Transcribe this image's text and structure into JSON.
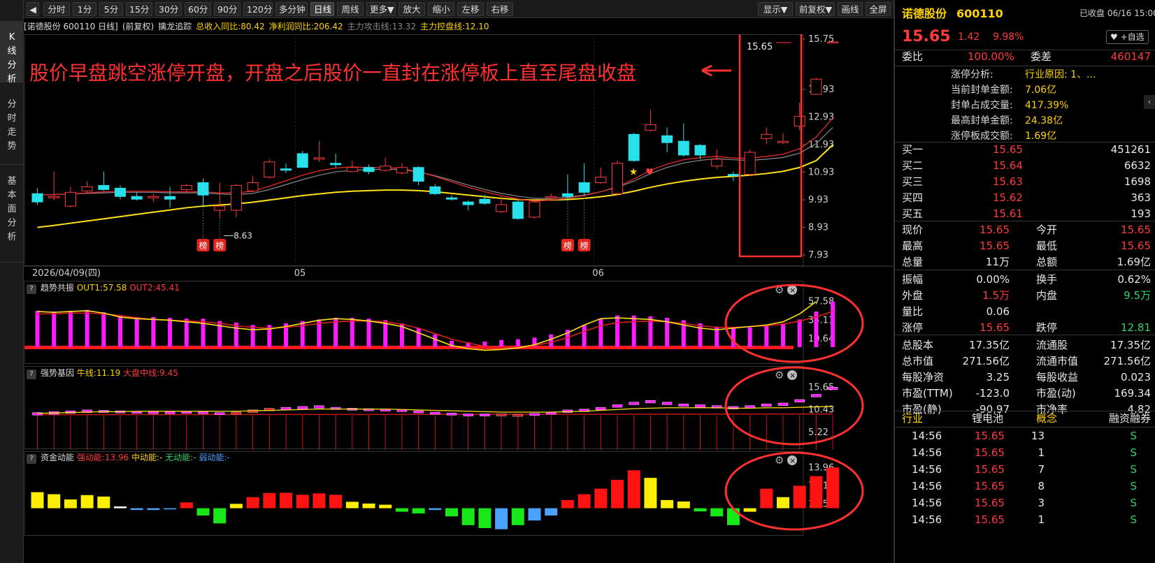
{
  "toolbar": {
    "collapse_icon": "left-arrow-icon",
    "periods": [
      "分时",
      "1分",
      "5分",
      "15分",
      "30分",
      "60分",
      "90分",
      "120分",
      "多分钟",
      "日线",
      "周线",
      "更多▼",
      "放大",
      "缩小",
      "左移",
      "右移"
    ],
    "active_period": "日线",
    "right_items": [
      "显示▼",
      "前复权▼",
      "画线",
      "全屏"
    ]
  },
  "left_tabs": [
    "K线分析",
    "分时走势",
    "基本面分析"
  ],
  "info_bar": {
    "stock": "[诺德股份 600110 日线]",
    "adjust": "(前复权)",
    "indicator": "擒龙追踪",
    "income_growth": "总收入同比:80.42",
    "profit_growth": "净利润同比:206.42",
    "attack_line": "主力攻击线:13.32",
    "control_line": "主力控盘线:12.10"
  },
  "annotation": "股价早盘跳空涨停开盘，开盘之后股价一直封在涨停板上直至尾盘收盘",
  "main_chart": {
    "y_ticks": [
      "15.75",
      "13.93",
      "12.93",
      "11.93",
      "10.93",
      "9.93",
      "8.93",
      "7.93"
    ],
    "x_labels": [
      "2026/04/09(四)",
      "05",
      "06"
    ],
    "last_price_label": "15.65",
    "low_label": "8.63",
    "badge_text": "榜"
  },
  "panel1": {
    "name": "趋势共振",
    "out1": "OUT1:57.58",
    "out2": "OUT2:45.41",
    "y_ticks": [
      "57.58",
      "34.11",
      "10.64"
    ]
  },
  "panel2": {
    "name": "强势基因",
    "bull": "牛线:11.19",
    "market": "大盘中线:9.45",
    "y_ticks": [
      "15.65",
      "10.43",
      "5.22"
    ]
  },
  "panel3": {
    "name": "资金动能",
    "strong": "强动能:13.96",
    "mid": "中动能:-",
    "none": "无动能:-",
    "weak": "弱动能:-",
    "y_ticks": [
      "13.96",
      "7.71",
      "1.45"
    ]
  },
  "quote": {
    "name": "诺德股份",
    "code": "600110",
    "status": "已收盘 06/16 15:00",
    "price": "15.65",
    "change": "1.42",
    "change_pct": "9.98%",
    "watch_button": "+自选",
    "wei_bi_label": "委比",
    "wei_bi": "100.00%",
    "wei_cha_label": "委差",
    "wei_cha": "460147",
    "limit": {
      "analysis_label": "涨停分析:",
      "analysis_value": "行业原因: 1、...",
      "seal_amount_label": "当前封单金额:",
      "seal_amount": "7.06亿",
      "seal_ratio_label": "封单占成交量:",
      "seal_ratio": "417.39%",
      "max_seal_label": "最高封单金额:",
      "max_seal": "24.38亿",
      "board_amount_label": "涨停板成交额:",
      "board_amount": "1.69亿"
    },
    "bids": [
      {
        "label": "买一",
        "price": "15.65",
        "vol": "451261"
      },
      {
        "label": "买二",
        "price": "15.64",
        "vol": "6632"
      },
      {
        "label": "买三",
        "price": "15.63",
        "vol": "1698"
      },
      {
        "label": "买四",
        "price": "15.62",
        "vol": "363"
      },
      {
        "label": "买五",
        "price": "15.61",
        "vol": "193"
      }
    ],
    "stats": [
      {
        "l1": "现价",
        "v1": "15.65",
        "c1": "red",
        "l2": "今开",
        "v2": "15.65",
        "c2": "red"
      },
      {
        "l1": "最高",
        "v1": "15.65",
        "c1": "red",
        "l2": "最低",
        "v2": "15.65",
        "c2": "red"
      },
      {
        "l1": "总量",
        "v1": "11万",
        "c1": "white",
        "l2": "总额",
        "v2": "1.69亿",
        "c2": "white"
      },
      {
        "l1": "振幅",
        "v1": "0.00%",
        "c1": "white",
        "l2": "换手",
        "v2": "0.62%",
        "c2": "white"
      },
      {
        "l1": "外盘",
        "v1": "1.5万",
        "c1": "red",
        "l2": "内盘",
        "v2": "9.5万",
        "c2": "green"
      },
      {
        "l1": "量比",
        "v1": "0.06",
        "c1": "white",
        "l2": "",
        "v2": "",
        "c2": "white"
      },
      {
        "l1": "涨停",
        "v1": "15.65",
        "c1": "red",
        "l2": "跌停",
        "v2": "12.81",
        "c2": "green"
      },
      {
        "l1": "总股本",
        "v1": "17.35亿",
        "c1": "white",
        "l2": "流通股",
        "v2": "17.35亿",
        "c2": "white"
      },
      {
        "l1": "总市值",
        "v1": "271.56亿",
        "c1": "white",
        "l2": "流通市值",
        "v2": "271.56亿",
        "c2": "white"
      },
      {
        "l1": "每股净资",
        "v1": "3.25",
        "c1": "white",
        "l2": "每股收益",
        "v2": "0.023",
        "c2": "white"
      },
      {
        "l1": "市盈(TTM)",
        "v1": "-123.0",
        "c1": "white",
        "l2": "市盈(动)",
        "v2": "169.34",
        "c2": "white"
      },
      {
        "l1": "市盈(静)",
        "v1": "-90.97",
        "c1": "white",
        "l2": "市净率",
        "v2": "4.82",
        "c2": "white"
      }
    ],
    "industry_label": "行业",
    "industry_value": "锂电池",
    "concept_label": "概念",
    "margin_label": "融资融券",
    "ticks": [
      {
        "time": "14:56",
        "price": "15.65",
        "vol": "13",
        "side": "S"
      },
      {
        "time": "14:56",
        "price": "15.65",
        "vol": "1",
        "side": "S"
      },
      {
        "time": "14:56",
        "price": "15.65",
        "vol": "7",
        "side": "S"
      },
      {
        "time": "14:56",
        "price": "15.65",
        "vol": "8",
        "side": "S"
      },
      {
        "time": "14:56",
        "price": "15.65",
        "vol": "3",
        "side": "S"
      },
      {
        "time": "14:56",
        "price": "15.65",
        "vol": "1",
        "side": "S"
      }
    ]
  },
  "chart_data": {
    "type": "candlestick",
    "ylim": [
      7.93,
      15.75
    ],
    "candles": [
      [
        10.15,
        9.85,
        10.35,
        9.75
      ],
      [
        10.0,
        10.05,
        10.95,
        9.9
      ],
      [
        9.7,
        10.2,
        10.4,
        9.65
      ],
      [
        10.25,
        10.4,
        10.6,
        10.15
      ],
      [
        10.45,
        10.3,
        10.95,
        10.25
      ],
      [
        10.35,
        10.05,
        10.45,
        9.95
      ],
      [
        10.05,
        9.95,
        10.2,
        9.9
      ],
      [
        10.0,
        10.05,
        10.15,
        9.85
      ],
      [
        10.05,
        9.95,
        10.4,
        9.65
      ],
      [
        10.3,
        10.45,
        10.5,
        10.15
      ],
      [
        10.55,
        10.1,
        10.7,
        9.65
      ],
      [
        9.55,
        9.7,
        10.55,
        9.25
      ],
      [
        9.55,
        10.45,
        10.5,
        9.3
      ],
      [
        10.25,
        10.55,
        10.8,
        10.2
      ],
      [
        10.75,
        11.3,
        11.4,
        10.7
      ],
      [
        11.05,
        11.0,
        11.25,
        10.9
      ],
      [
        11.6,
        11.1,
        11.7,
        11.1
      ],
      [
        11.4,
        11.45,
        12.05,
        11.3
      ],
      [
        11.25,
        11.2,
        11.6,
        11.1
      ],
      [
        10.95,
        11.1,
        11.35,
        10.95
      ],
      [
        11.1,
        10.95,
        11.2,
        10.85
      ],
      [
        11.0,
        11.15,
        11.45,
        10.95
      ],
      [
        10.9,
        11.1,
        11.25,
        10.85
      ],
      [
        11.1,
        10.6,
        11.15,
        10.45
      ],
      [
        10.4,
        10.15,
        10.5,
        10.1
      ],
      [
        10.0,
        9.95,
        10.1,
        9.9
      ],
      [
        9.85,
        9.75,
        9.9,
        9.55
      ],
      [
        9.95,
        9.8,
        10.1,
        9.75
      ],
      [
        9.5,
        9.75,
        10.05,
        9.45
      ],
      [
        9.85,
        9.25,
        9.9,
        9.2
      ],
      [
        9.3,
        9.85,
        10.0,
        9.25
      ],
      [
        10.0,
        10.05,
        10.15,
        9.95
      ],
      [
        10.15,
        10.05,
        10.85,
        9.9
      ],
      [
        10.55,
        10.2,
        11.25,
        10.05
      ],
      [
        10.55,
        10.75,
        11.1,
        10.5
      ],
      [
        10.15,
        11.25,
        11.35,
        10.1
      ],
      [
        12.3,
        11.35,
        12.35,
        11.3
      ],
      [
        12.45,
        12.65,
        13.2,
        12.4
      ],
      [
        12.25,
        12.0,
        12.55,
        11.65
      ],
      [
        12.05,
        11.55,
        12.7,
        11.5
      ],
      [
        11.9,
        11.55,
        11.95,
        11.4
      ],
      [
        11.15,
        11.4,
        11.75,
        11.05
      ],
      [
        10.85,
        10.8,
        10.95,
        10.6
      ],
      [
        10.85,
        11.65,
        11.75,
        10.8
      ],
      [
        12.15,
        12.3,
        12.55,
        11.95
      ],
      [
        12.0,
        12.05,
        12.35,
        11.95
      ],
      [
        12.6,
        12.95,
        13.45,
        12.45
      ],
      [
        13.75,
        14.3,
        14.35,
        13.75
      ],
      [
        15.65,
        15.65,
        15.65,
        15.65
      ]
    ],
    "ma_red": [
      10.1,
      10.12,
      10.14,
      10.18,
      10.22,
      10.24,
      10.24,
      10.24,
      10.22,
      10.22,
      10.22,
      10.18,
      10.18,
      10.24,
      10.42,
      10.62,
      10.82,
      10.98,
      11.08,
      11.12,
      11.1,
      11.1,
      11.06,
      10.94,
      10.78,
      10.58,
      10.38,
      10.22,
      10.08,
      9.96,
      9.88,
      9.92,
      9.98,
      10.08,
      10.22,
      10.4,
      10.68,
      11.0,
      11.22,
      11.38,
      11.46,
      11.5,
      11.44,
      11.44,
      11.5,
      11.58,
      11.78,
      12.2,
      12.9
    ],
    "ma_gray": [
      10.1,
      10.12,
      10.14,
      10.16,
      10.18,
      10.2,
      10.2,
      10.2,
      10.18,
      10.18,
      10.18,
      10.14,
      10.12,
      10.16,
      10.3,
      10.48,
      10.66,
      10.82,
      10.94,
      11.0,
      11.02,
      11.04,
      11.02,
      10.94,
      10.8,
      10.64,
      10.46,
      10.3,
      10.16,
      10.06,
      9.98,
      9.98,
      10.02,
      10.1,
      10.22,
      10.38,
      10.6,
      10.88,
      11.1,
      11.26,
      11.36,
      11.42,
      11.38,
      11.36,
      11.4,
      11.46,
      11.62,
      11.96,
      12.55
    ],
    "ma_yellow": [
      8.93,
      9.0,
      9.08,
      9.16,
      9.24,
      9.32,
      9.4,
      9.48,
      9.56,
      9.64,
      9.7,
      9.74,
      9.78,
      9.84,
      9.92,
      10.0,
      10.08,
      10.14,
      10.2,
      10.24,
      10.26,
      10.28,
      10.28,
      10.26,
      10.22,
      10.16,
      10.1,
      10.04,
      9.98,
      9.94,
      9.92,
      9.92,
      9.94,
      9.98,
      10.04,
      10.12,
      10.24,
      10.38,
      10.5,
      10.6,
      10.68,
      10.74,
      10.78,
      10.82,
      10.88,
      10.96,
      11.1,
      11.35,
      11.92
    ],
    "panel1_bars": [
      46,
      45,
      46,
      47,
      44,
      40,
      38,
      38,
      37,
      36,
      36,
      33,
      31,
      28,
      28,
      30,
      33,
      35,
      37,
      37,
      36,
      34,
      30,
      24,
      16,
      8,
      6,
      7,
      9,
      10,
      12,
      16,
      22,
      28,
      36,
      40,
      40,
      39,
      37,
      34,
      30,
      26,
      25,
      25,
      27,
      30,
      35,
      45,
      57.58
    ],
    "panel1_out1": [
      45,
      44,
      45,
      46,
      43,
      38,
      36,
      35,
      34,
      32,
      30,
      27,
      24,
      22,
      23,
      26,
      30,
      34,
      36,
      35,
      33,
      30,
      26,
      18,
      10,
      2,
      -2,
      -4,
      -3,
      -1,
      3,
      10,
      18,
      28,
      36,
      37,
      36,
      35,
      32,
      28,
      24,
      22,
      24,
      26,
      28,
      32,
      42,
      57.58
    ],
    "panel1_out2": [
      42,
      42,
      43,
      43,
      42,
      40,
      37,
      35,
      34,
      33,
      32,
      30,
      27,
      25,
      24,
      25,
      27,
      30,
      32,
      33,
      33,
      32,
      29,
      24,
      17,
      10,
      5,
      1,
      0,
      0,
      2,
      6,
      12,
      20,
      27,
      31,
      32,
      33,
      32,
      30,
      27,
      25,
      25,
      26,
      27,
      29,
      33,
      38,
      45.41
    ],
    "panel2_boxes": [
      [
        9.2,
        9.8
      ],
      [
        9.4,
        10.0
      ],
      [
        9.6,
        10.2
      ],
      [
        9.8,
        10.4
      ],
      [
        9.8,
        10.3
      ],
      [
        9.7,
        10.2
      ],
      [
        9.7,
        10.1
      ],
      [
        9.6,
        10.0
      ],
      [
        9.6,
        10.0
      ],
      [
        9.7,
        10.1
      ],
      [
        9.6,
        10.0
      ],
      [
        9.4,
        9.8
      ],
      [
        9.5,
        9.9
      ],
      [
        9.8,
        10.4
      ],
      [
        10.2,
        10.8
      ],
      [
        10.4,
        11.0
      ],
      [
        10.6,
        11.2
      ],
      [
        10.8,
        11.4
      ],
      [
        10.6,
        11.0
      ],
      [
        10.4,
        10.8
      ],
      [
        10.2,
        10.7
      ],
      [
        10.2,
        10.6
      ],
      [
        10.0,
        10.5
      ],
      [
        9.7,
        10.2
      ],
      [
        9.4,
        9.9
      ],
      [
        9.2,
        9.7
      ],
      [
        9.0,
        9.5
      ],
      [
        9.0,
        9.5
      ],
      [
        9.0,
        9.5
      ],
      [
        9.0,
        9.4
      ],
      [
        9.1,
        9.6
      ],
      [
        9.4,
        9.9
      ],
      [
        9.8,
        10.4
      ],
      [
        10.0,
        10.6
      ],
      [
        10.4,
        11.0
      ],
      [
        11.0,
        11.6
      ],
      [
        11.6,
        12.2
      ],
      [
        12.0,
        12.6
      ],
      [
        11.6,
        12.2
      ],
      [
        11.2,
        11.8
      ],
      [
        11.0,
        11.6
      ],
      [
        10.8,
        11.4
      ],
      [
        10.6,
        11.2
      ],
      [
        10.8,
        11.4
      ],
      [
        11.2,
        11.8
      ],
      [
        11.4,
        12.0
      ],
      [
        12.2,
        12.8
      ],
      [
        13.4,
        14.0
      ],
      [
        15.1,
        15.65
      ]
    ],
    "panel2_bull": [
      9.6,
      9.7,
      9.8,
      9.9,
      10.0,
      10.0,
      10.1,
      10.1,
      10.1,
      10.1,
      10.1,
      10.1,
      10.1,
      10.2,
      10.3,
      10.4,
      10.5,
      10.6,
      10.6,
      10.6,
      10.6,
      10.6,
      10.5,
      10.4,
      10.3,
      10.2,
      10.1,
      10.0,
      9.9,
      9.9,
      9.9,
      9.9,
      10.0,
      10.1,
      10.3,
      10.5,
      10.7,
      10.8,
      10.9,
      10.9,
      10.9,
      10.9,
      10.8,
      10.8,
      10.9,
      10.9,
      11.0,
      11.1,
      11.19
    ],
    "panel3_bars": [
      5.5,
      4.8,
      3.0,
      4.5,
      4.0,
      0.6,
      -0.6,
      -0.6,
      -0.4,
      2.0,
      -2.5,
      -5.2,
      1.5,
      3.8,
      5.2,
      5.3,
      4.6,
      5.1,
      4.6,
      2.2,
      1.6,
      1.2,
      -1.2,
      -1.8,
      -0.6,
      -2.8,
      -5.8,
      -6.8,
      -7.2,
      -5.8,
      -4.2,
      -2.5,
      2.8,
      4.8,
      6.7,
      9.7,
      13.0,
      10.4,
      2.8,
      2.3,
      -1.1,
      -2.8,
      -5.8,
      -1.2,
      6.7,
      3.8,
      7.7,
      11.0,
      13.96
    ],
    "panel3_colors": [
      "y",
      "y",
      "y",
      "y",
      "y",
      "w",
      "b",
      "b",
      "b",
      "r",
      "g",
      "g",
      "y",
      "r",
      "r",
      "r",
      "r",
      "r",
      "r",
      "y",
      "y",
      "y",
      "g",
      "g",
      "b",
      "g",
      "g",
      "g",
      "b",
      "g",
      "b",
      "b",
      "r",
      "r",
      "r",
      "r",
      "r",
      "y",
      "y",
      "y",
      "g",
      "g",
      "g",
      "y",
      "r",
      "y",
      "r",
      "r",
      "r"
    ]
  }
}
